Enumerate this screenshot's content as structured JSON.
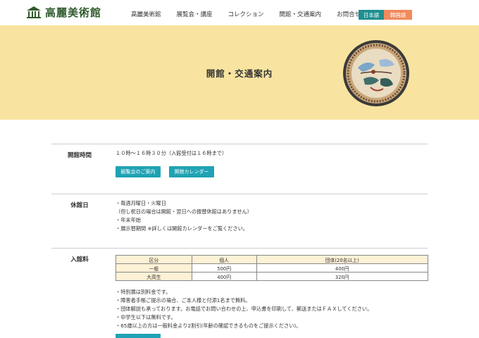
{
  "header": {
    "logo_text": "高麗美術館",
    "nav": [
      "高麗美術館",
      "展覧会・講座",
      "コレクション",
      "開館・交通案内",
      "お問合せ"
    ],
    "lang_ja": "日本語",
    "lang_ko": "韓国語"
  },
  "hero": {
    "title": "開館・交通案内"
  },
  "hours": {
    "label": "開館時間",
    "text": "１０時～１６時３０分（入館受付は１６時まで）",
    "btn_exhibitions": "観覧会のご案内",
    "btn_calendar": "開館カレンダー"
  },
  "closed": {
    "label": "休館日",
    "lines": [
      "・毎週月曜日・火曜日",
      "（但し祝日の場合は開館・翌日への振替休館はありません）",
      "・年末年始",
      "・展示替期間 ※詳しくは開館カレンダーをご覧ください。"
    ]
  },
  "fees": {
    "label": "入館料",
    "headers": [
      "区分",
      "個人",
      "団体(20名以上)"
    ],
    "rows": [
      [
        "一般",
        "500円",
        "400円"
      ],
      [
        "大高生",
        "400円",
        "320円"
      ]
    ],
    "notes": [
      "・特別展は別料金です。",
      "・障害者手帳ご提示の場合、ご本人様と付添1名まで無料。",
      "・団体解説も承っております。お電話でお問い合わせの上、申込書を印刷して、郵送またはＦＡＸしてください。",
      "・中学生以下は無料です。",
      "・65歳以上の方は一般料金より2割引(年齢の確認できるものをご提示ください)。"
    ]
  },
  "colors": {
    "hero_bg": "#f8e4a0",
    "accent_teal": "#1fa3b4",
    "lang_ja_bg": "#1f8f8f",
    "lang_ko_bg": "#f08a5d",
    "table_header_bg": "#fdf1d6",
    "logo_green": "#2f5a2a"
  }
}
